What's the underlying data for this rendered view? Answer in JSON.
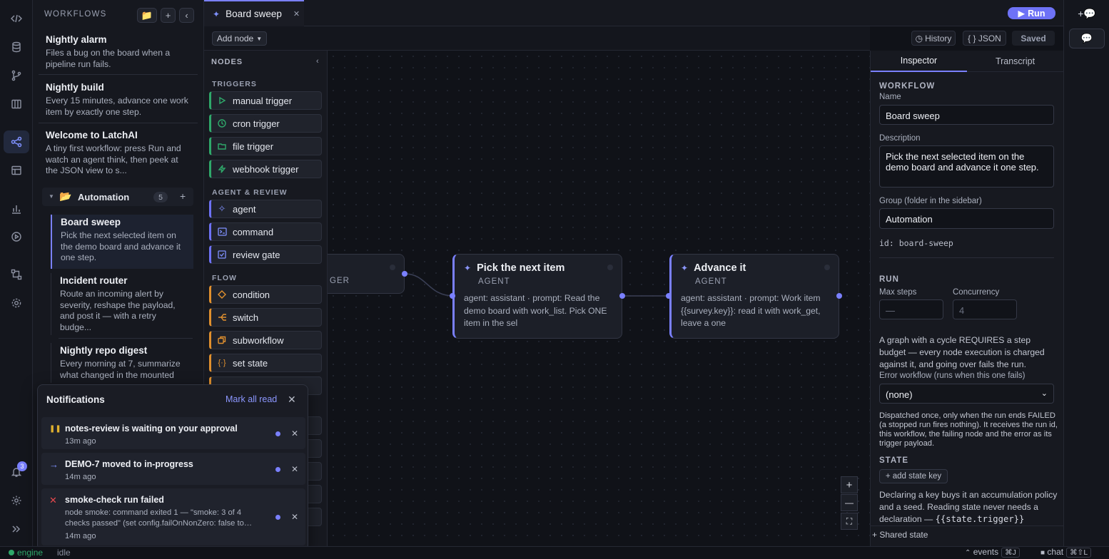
{
  "sidebar": {
    "heading": "WORKFLOWS",
    "workflows": [
      {
        "title": "Nightly alarm",
        "desc": "Files a bug on the board when a pipeline run fails."
      },
      {
        "title": "Nightly build",
        "desc": "Every 15 minutes, advance one work item by exactly one step."
      },
      {
        "title": "Welcome to LatchAI",
        "desc": "A tiny first workflow: press Run and watch an agent think, then peek at the JSON view to s..."
      }
    ],
    "group": {
      "name": "Automation",
      "count": "5"
    },
    "group_items": [
      {
        "title": "Board sweep",
        "desc": "Pick the next selected item on the demo board and advance it one step."
      },
      {
        "title": "Incident router",
        "desc": "Route an incoming alert by severity, reshape the payload, and post it — with a retry budge..."
      },
      {
        "title": "Nightly repo digest",
        "desc": "Every morning at 7, summarize what changed in the mounted"
      }
    ]
  },
  "tabs": [
    {
      "label": "Board sweep"
    }
  ],
  "run_label": "Run",
  "toolbar": {
    "add_node": "Add node",
    "history": "History",
    "json": "{ } JSON",
    "saved": "Saved"
  },
  "palette": {
    "heading": "NODES",
    "sections": {
      "triggers": "TRIGGERS",
      "agent": "AGENT & REVIEW",
      "flow": "FLOW"
    },
    "triggers": [
      "manual trigger",
      "cron trigger",
      "file trigger",
      "webhook trigger"
    ],
    "agent": [
      "agent",
      "command",
      "review gate"
    ],
    "flow": [
      "condition",
      "switch",
      "subworkflow",
      "set state"
    ]
  },
  "graph": {
    "nodes": [
      {
        "title": "",
        "subtitle": "GER",
        "desc": ""
      },
      {
        "title": "Pick the next item",
        "subtitle": "AGENT",
        "desc": "agent: assistant · prompt: Read the demo board with work_list. Pick ONE item in the sel"
      },
      {
        "title": "Advance it",
        "subtitle": "AGENT",
        "desc": "agent: assistant · prompt: Work item {{survey.key}}: read it with work_get, leave a one"
      }
    ]
  },
  "zoom": {
    "in": "+",
    "out": "—",
    "fit": "⛶"
  },
  "inspector": {
    "tabs": [
      "Inspector",
      "Transcript"
    ],
    "workflow_caption": "WORKFLOW",
    "name_label": "Name",
    "name_value": "Board sweep",
    "desc_label": "Description",
    "desc_value": "Pick the next selected item on the demo board and advance it one step.",
    "group_label": "Group (folder in the sidebar)",
    "group_value": "Automation",
    "id_text": "id: board-sweep",
    "run_caption": "RUN",
    "max_steps_label": "Max steps",
    "max_steps_placeholder": "—",
    "concurrency_label": "Concurrency",
    "concurrency_placeholder": "4",
    "cycle_note": "A graph with a cycle REQUIRES a step budget — every node execution is charged against it, and going over fails the run.",
    "error_label": "Error workflow (runs when this one fails)",
    "error_value": "(none)",
    "dispatch_note": "Dispatched once, only when the run ends FAILED (a stopped run fires nothing). It receives the run id, this workflow, the failing node and the error as its trigger payload.",
    "state_caption": "STATE",
    "add_state": "+ add state key",
    "state_note": "Declaring a key buys it an accumulation policy and a seed. Reading state never needs a declaration — ",
    "state_code": "{{state.trigger}}",
    "shared_state": "+ Shared state"
  },
  "notifications": {
    "title": "Notifications",
    "mark_all": "Mark all read",
    "items": [
      {
        "icon": "pause",
        "title": "notes-review is waiting on your approval",
        "body": "",
        "time": "13m ago"
      },
      {
        "icon": "arrow",
        "title": "DEMO-7 moved to in-progress",
        "body": "",
        "time": "14m ago"
      },
      {
        "icon": "x",
        "title": "smoke-check run failed",
        "body": "node smoke: command exited 1 — \"smoke: 3 of 4 checks passed\" (set config.failOnNonZero: false to…",
        "time": "14m ago"
      }
    ]
  },
  "rail": {
    "notif_count": "3"
  },
  "status": {
    "engine": "engine",
    "engine_state": "idle",
    "events": "events",
    "events_kbd": "⌘J",
    "chat": "chat",
    "chat_kbd": "⌘⇧L"
  },
  "colors": {
    "accent": "#7a80ff",
    "trigger": "#2fa86a",
    "flow": "#e0902e",
    "error": "#e5484d"
  }
}
